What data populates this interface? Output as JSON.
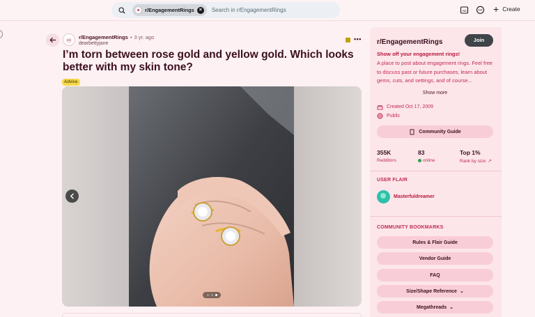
{
  "topbar": {
    "community_chip": "r/EngagementRings",
    "search_placeholder": "Search in r/EngagementRings",
    "create_label": "Create"
  },
  "post": {
    "subreddit": "r/EngagementRings",
    "separator": "•",
    "age": "3 yr. ago",
    "author": "dearbettyjane",
    "title": "I’m torn between rose gold and yellow gold. Which looks better with my skin tone?",
    "flair": "Advice",
    "more_label": "•••",
    "gallery": {
      "image_count": 3,
      "current_index": 3
    }
  },
  "sidebar": {
    "name": "r/EngagementRings",
    "join_label": "Join",
    "tagline": "Show off your engagement rings!",
    "description": "A place to post about engagement rings. Feel free to discuss past or future purchases, learn about gems, cuts, and settings, and of course...",
    "show_more": "Show more",
    "created": "Created Oct 17, 2009",
    "visibility": "Public",
    "community_guide": "Community Guide",
    "stats": [
      {
        "value": "355K",
        "label": "Redditors"
      },
      {
        "value": "83",
        "label": "online"
      },
      {
        "value": "Top 1%",
        "label": "Rank by size"
      }
    ],
    "user_flair_heading": "USER FLAIR",
    "user_flair_name": "Masterfuldreamer",
    "bookmarks_heading": "COMMUNITY BOOKMARKS",
    "bookmarks": [
      "Rules & Flair Guide",
      "Vendor Guide",
      "FAQ",
      "Size/Shape Reference",
      "Megathreads"
    ]
  },
  "colors": {
    "accent": "#c22a52",
    "background": "#fdf1f3",
    "sidebar": "#fce6ea",
    "button": "#f8cdd7"
  }
}
